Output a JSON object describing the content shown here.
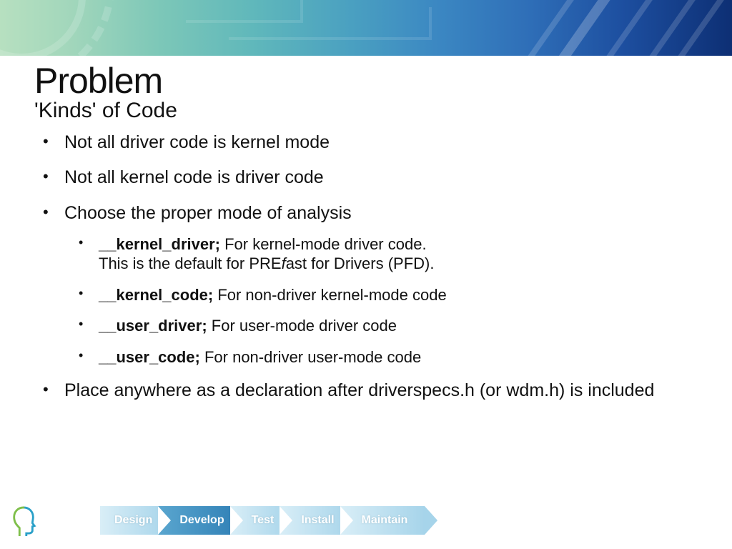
{
  "title": "Problem",
  "subtitle": "'Kinds' of Code",
  "bullets": {
    "b1": "Not all driver code is kernel mode",
    "b2": "Not all kernel code is driver code",
    "b3": "Choose the proper mode of analysis",
    "b4": "Place anywhere as a declaration after driverspecs.h (or wdm.h) is included"
  },
  "modes": {
    "kd": {
      "name": "__kernel_driver;",
      "desc_a": " For kernel-mode driver code.",
      "desc_b1": "This is the default for PRE",
      "desc_b_italic": "f",
      "desc_b2": "ast for Drivers (PFD)."
    },
    "kc": {
      "name": "__kernel_code;",
      "desc": " For non-driver kernel-mode code"
    },
    "ud": {
      "name": "__user_driver;",
      "desc": " For user-mode driver code"
    },
    "uc": {
      "name": "__user_code;",
      "desc": " For non-driver user-mode code"
    }
  },
  "stages": {
    "s1": "Design",
    "s2": "Develop",
    "s3": "Test",
    "s4": "Install",
    "s5": "Maintain"
  }
}
